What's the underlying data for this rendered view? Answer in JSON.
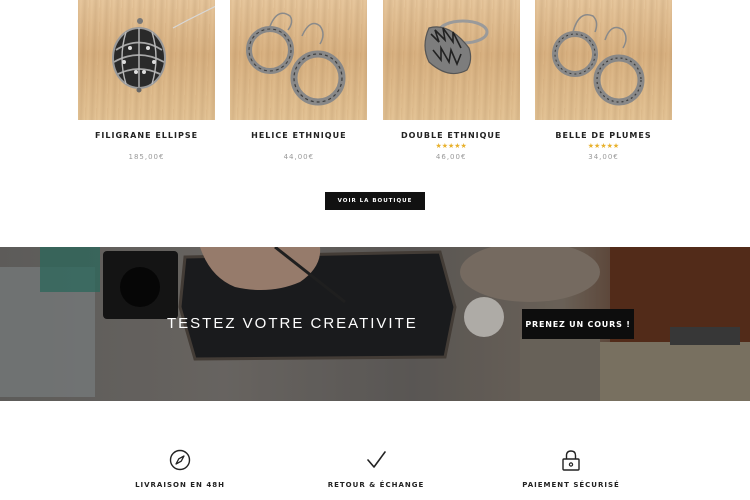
{
  "products": [
    {
      "name": "FILIGRANE ELLIPSE",
      "price": "185,00€",
      "rating": null,
      "image_icon": "filigree-pendant"
    },
    {
      "name": "HELICE ETHNIQUE",
      "price": "44,00€",
      "rating": null,
      "image_icon": "hoop-earrings"
    },
    {
      "name": "DOUBLE ETHNIQUE",
      "price": "46,00€",
      "rating": "★★★★★",
      "image_icon": "ethnic-ring"
    },
    {
      "name": "BELLE DE PLUMES",
      "price": "34,00€",
      "rating": "★★★★★",
      "image_icon": "feather-earrings"
    }
  ],
  "shop_button": "VOIR LA BOUTIQUE",
  "banner": {
    "title": "TESTEZ VOTRE CREATIVITE",
    "button": "PRENEZ UN COURS !"
  },
  "features": [
    {
      "label": "LIVRAISON EN 48H",
      "icon": "compass-icon"
    },
    {
      "label": "RETOUR & ÉCHANGE",
      "icon": "checkmark-icon"
    },
    {
      "label": "PAIEMENT SÉCURISÉ",
      "icon": "lock-icon"
    }
  ],
  "colors": {
    "star": "#e8b12c",
    "button_bg": "#111111",
    "price": "#999999"
  }
}
